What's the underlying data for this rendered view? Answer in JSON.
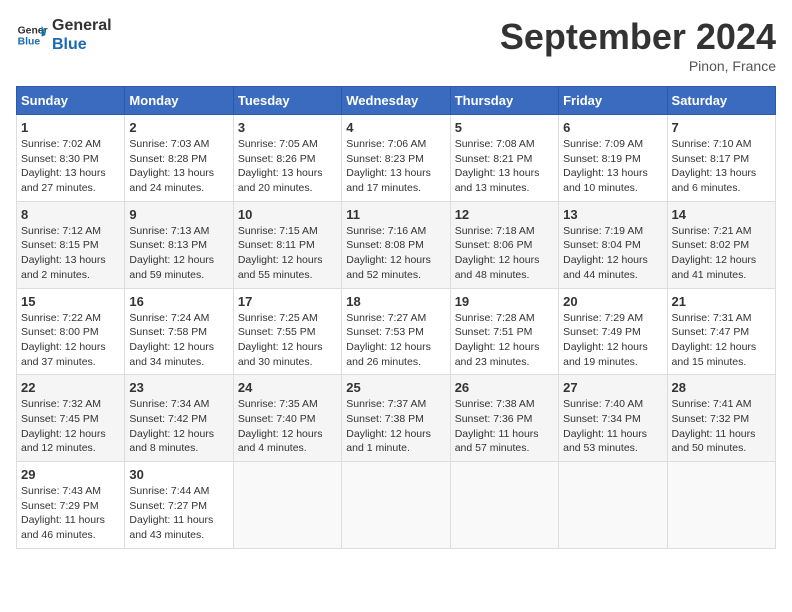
{
  "header": {
    "logo_line1": "General",
    "logo_line2": "Blue",
    "month_year": "September 2024",
    "location": "Pinon, France"
  },
  "weekdays": [
    "Sunday",
    "Monday",
    "Tuesday",
    "Wednesday",
    "Thursday",
    "Friday",
    "Saturday"
  ],
  "weeks": [
    [
      {
        "day": "1",
        "info": "Sunrise: 7:02 AM\nSunset: 8:30 PM\nDaylight: 13 hours\nand 27 minutes."
      },
      {
        "day": "2",
        "info": "Sunrise: 7:03 AM\nSunset: 8:28 PM\nDaylight: 13 hours\nand 24 minutes."
      },
      {
        "day": "3",
        "info": "Sunrise: 7:05 AM\nSunset: 8:26 PM\nDaylight: 13 hours\nand 20 minutes."
      },
      {
        "day": "4",
        "info": "Sunrise: 7:06 AM\nSunset: 8:23 PM\nDaylight: 13 hours\nand 17 minutes."
      },
      {
        "day": "5",
        "info": "Sunrise: 7:08 AM\nSunset: 8:21 PM\nDaylight: 13 hours\nand 13 minutes."
      },
      {
        "day": "6",
        "info": "Sunrise: 7:09 AM\nSunset: 8:19 PM\nDaylight: 13 hours\nand 10 minutes."
      },
      {
        "day": "7",
        "info": "Sunrise: 7:10 AM\nSunset: 8:17 PM\nDaylight: 13 hours\nand 6 minutes."
      }
    ],
    [
      {
        "day": "8",
        "info": "Sunrise: 7:12 AM\nSunset: 8:15 PM\nDaylight: 13 hours\nand 2 minutes."
      },
      {
        "day": "9",
        "info": "Sunrise: 7:13 AM\nSunset: 8:13 PM\nDaylight: 12 hours\nand 59 minutes."
      },
      {
        "day": "10",
        "info": "Sunrise: 7:15 AM\nSunset: 8:11 PM\nDaylight: 12 hours\nand 55 minutes."
      },
      {
        "day": "11",
        "info": "Sunrise: 7:16 AM\nSunset: 8:08 PM\nDaylight: 12 hours\nand 52 minutes."
      },
      {
        "day": "12",
        "info": "Sunrise: 7:18 AM\nSunset: 8:06 PM\nDaylight: 12 hours\nand 48 minutes."
      },
      {
        "day": "13",
        "info": "Sunrise: 7:19 AM\nSunset: 8:04 PM\nDaylight: 12 hours\nand 44 minutes."
      },
      {
        "day": "14",
        "info": "Sunrise: 7:21 AM\nSunset: 8:02 PM\nDaylight: 12 hours\nand 41 minutes."
      }
    ],
    [
      {
        "day": "15",
        "info": "Sunrise: 7:22 AM\nSunset: 8:00 PM\nDaylight: 12 hours\nand 37 minutes."
      },
      {
        "day": "16",
        "info": "Sunrise: 7:24 AM\nSunset: 7:58 PM\nDaylight: 12 hours\nand 34 minutes."
      },
      {
        "day": "17",
        "info": "Sunrise: 7:25 AM\nSunset: 7:55 PM\nDaylight: 12 hours\nand 30 minutes."
      },
      {
        "day": "18",
        "info": "Sunrise: 7:27 AM\nSunset: 7:53 PM\nDaylight: 12 hours\nand 26 minutes."
      },
      {
        "day": "19",
        "info": "Sunrise: 7:28 AM\nSunset: 7:51 PM\nDaylight: 12 hours\nand 23 minutes."
      },
      {
        "day": "20",
        "info": "Sunrise: 7:29 AM\nSunset: 7:49 PM\nDaylight: 12 hours\nand 19 minutes."
      },
      {
        "day": "21",
        "info": "Sunrise: 7:31 AM\nSunset: 7:47 PM\nDaylight: 12 hours\nand 15 minutes."
      }
    ],
    [
      {
        "day": "22",
        "info": "Sunrise: 7:32 AM\nSunset: 7:45 PM\nDaylight: 12 hours\nand 12 minutes."
      },
      {
        "day": "23",
        "info": "Sunrise: 7:34 AM\nSunset: 7:42 PM\nDaylight: 12 hours\nand 8 minutes."
      },
      {
        "day": "24",
        "info": "Sunrise: 7:35 AM\nSunset: 7:40 PM\nDaylight: 12 hours\nand 4 minutes."
      },
      {
        "day": "25",
        "info": "Sunrise: 7:37 AM\nSunset: 7:38 PM\nDaylight: 12 hours\nand 1 minute."
      },
      {
        "day": "26",
        "info": "Sunrise: 7:38 AM\nSunset: 7:36 PM\nDaylight: 11 hours\nand 57 minutes."
      },
      {
        "day": "27",
        "info": "Sunrise: 7:40 AM\nSunset: 7:34 PM\nDaylight: 11 hours\nand 53 minutes."
      },
      {
        "day": "28",
        "info": "Sunrise: 7:41 AM\nSunset: 7:32 PM\nDaylight: 11 hours\nand 50 minutes."
      }
    ],
    [
      {
        "day": "29",
        "info": "Sunrise: 7:43 AM\nSunset: 7:29 PM\nDaylight: 11 hours\nand 46 minutes."
      },
      {
        "day": "30",
        "info": "Sunrise: 7:44 AM\nSunset: 7:27 PM\nDaylight: 11 hours\nand 43 minutes."
      },
      {
        "day": "",
        "info": ""
      },
      {
        "day": "",
        "info": ""
      },
      {
        "day": "",
        "info": ""
      },
      {
        "day": "",
        "info": ""
      },
      {
        "day": "",
        "info": ""
      }
    ]
  ]
}
